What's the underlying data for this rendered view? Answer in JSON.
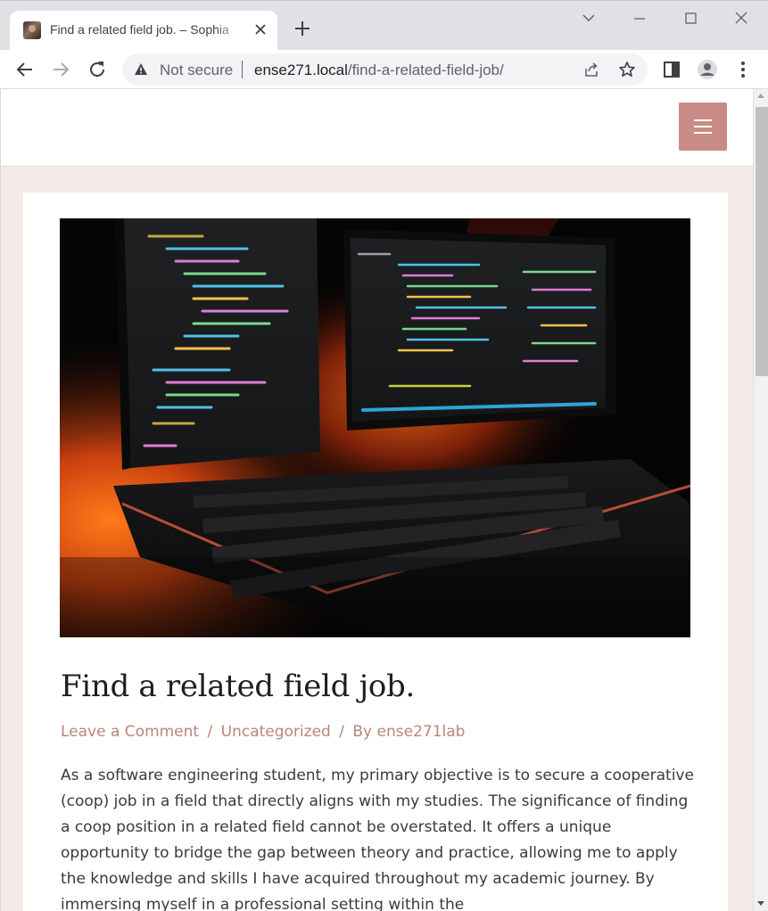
{
  "browser": {
    "tab": {
      "title": "Find a related field job. – Sophia",
      "favicon": "site-avatar-icon"
    },
    "new_tab_icon": "plus-icon",
    "omnibox": {
      "security_label": "Not secure",
      "url_host": "ense271.local",
      "url_path": "/find-a-related-field-job/"
    },
    "icons": {
      "back": "back-arrow-icon",
      "forward": "forward-arrow-icon",
      "reload": "reload-icon",
      "share": "share-icon",
      "bookmark": "star-icon",
      "side_panel": "side-panel-icon",
      "profile": "profile-icon",
      "menu": "kebab-menu-icon"
    }
  },
  "site": {
    "menu_icon": "hamburger-menu-icon",
    "accent_color": "#c98b85"
  },
  "post": {
    "title": "Find a related field job.",
    "meta": {
      "comment_link": "Leave a Comment",
      "separator": "/",
      "category": "Uncategorized",
      "by_label": "By",
      "author": "ense271lab"
    },
    "body": "As a software engineering student, my primary objective is to secure a cooperative (coop) job in a field that directly aligns with my studies. The significance of finding a coop position in a related field cannot be overstated. It offers a unique opportunity to bridge the gap between theory and practice, allowing me to apply the knowledge and skills I have acquired throughout my academic journey. By immersing myself in a professional setting within the"
  }
}
